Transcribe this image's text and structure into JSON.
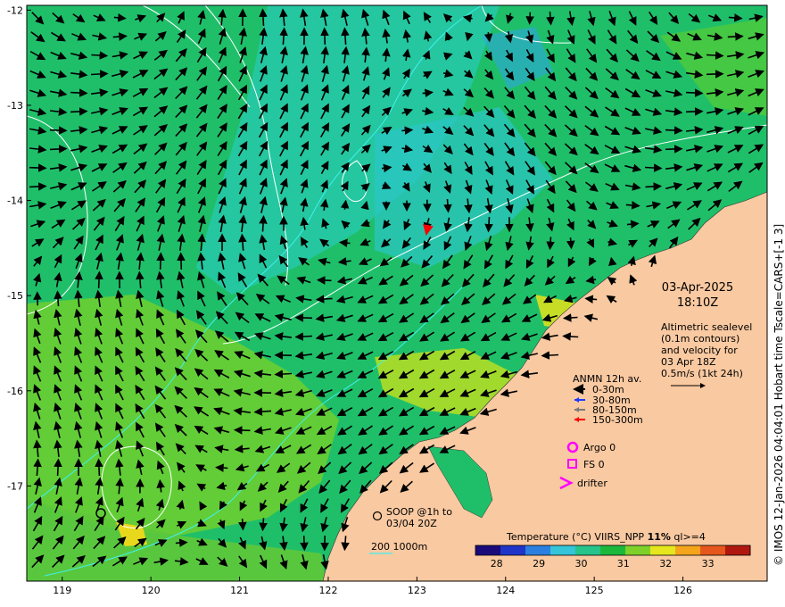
{
  "map": {
    "lon_ticks": [
      "119",
      "120",
      "121",
      "122",
      "123",
      "124",
      "125",
      "126"
    ],
    "lat_ticks": [
      "-12",
      "-13",
      "-14",
      "-15",
      "-16",
      "-17"
    ],
    "extent": {
      "lon_min": 118.6,
      "lon_max": 126.95,
      "lat_min": -18.0,
      "lat_max": -11.95
    }
  },
  "date": {
    "day": "03-Apr-2025",
    "time": "18:10Z"
  },
  "altimetry": {
    "lines": [
      "Altimetric sealevel",
      "(0.1m contours)",
      "and velocity for",
      "03 Apr 18Z",
      "0.5m/s (1kt 24h)"
    ]
  },
  "anmn": {
    "title": "ANMN 12h av.",
    "items": [
      {
        "label": "0-30m",
        "color": "#000000"
      },
      {
        "label": "30-80m",
        "color": "#1e3cff"
      },
      {
        "label": "80-150m",
        "color": "#7a7a7a"
      },
      {
        "label": "150-300m",
        "color": "#ff0000"
      }
    ]
  },
  "platforms": {
    "argo": "Argo 0",
    "fs": "FS 0",
    "drifter": "drifter",
    "color": "#ff00ff"
  },
  "soop": {
    "line1": "SOOP @1h to",
    "line2": "03/04 20Z"
  },
  "bathy": {
    "label": "200  1000m"
  },
  "colorbar": {
    "title": "Temperature (°C) VIIRS_NPP ",
    "title_bold": "11%",
    "title_end": " ql>=4",
    "ticks": [
      "28",
      "29",
      "30",
      "31",
      "32",
      "33"
    ],
    "colors": [
      "#1a0a7a",
      "#1f35c8",
      "#2b7fe0",
      "#35c4d8",
      "#26c48a",
      "#1cb83c",
      "#7fd12a",
      "#e6e61e",
      "#f5a51c",
      "#e5571c",
      "#b0180f"
    ]
  },
  "credit": "© IMOS 12-Jan-2026 04:04:01 Hobart time Tscale=CARS+[-1 3]"
}
